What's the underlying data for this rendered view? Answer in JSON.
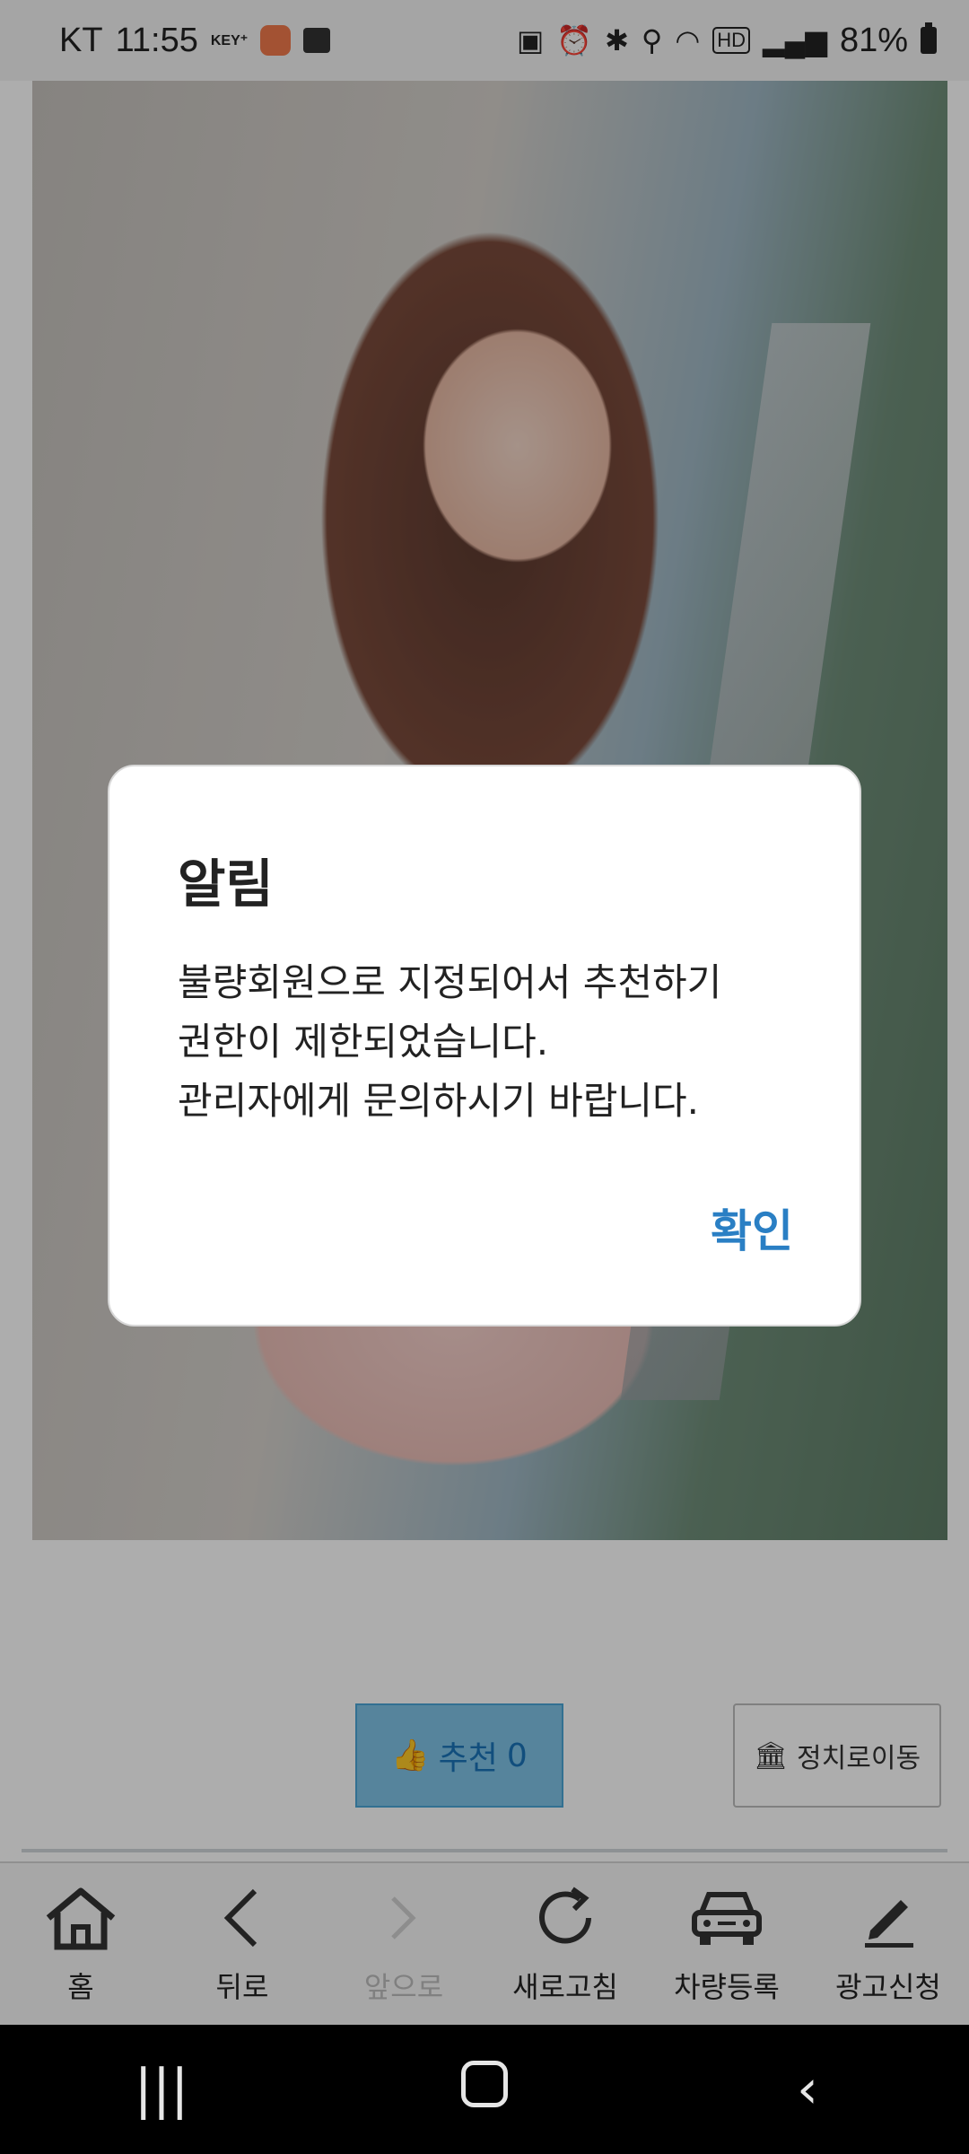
{
  "status_bar": {
    "carrier": "KT",
    "time": "11:55",
    "key_badge": "KEY⁺",
    "battery": "81%"
  },
  "page": {
    "recommend_button": {
      "label": "추천",
      "count": "0"
    },
    "parking_button": {
      "label": "정치로이동"
    }
  },
  "dialog": {
    "title": "알림",
    "message_lines": [
      "불량회원으로 지정되어서 추천하기",
      "권한이 제한되었습니다.",
      "관리자에게 문의하시기 바랍니다."
    ],
    "confirm": "확인"
  },
  "toolbar": {
    "items": [
      {
        "label": "홈",
        "icon": "home-icon",
        "enabled": true
      },
      {
        "label": "뒤로",
        "icon": "back-icon",
        "enabled": true
      },
      {
        "label": "앞으로",
        "icon": "forward-icon",
        "enabled": false
      },
      {
        "label": "새로고침",
        "icon": "refresh-icon",
        "enabled": true
      },
      {
        "label": "차량등록",
        "icon": "car-icon",
        "enabled": true
      },
      {
        "label": "광고신청",
        "icon": "pencil-icon",
        "enabled": true
      }
    ]
  },
  "navbar": {
    "icons": [
      "recent-apps-icon",
      "home-icon",
      "back-icon"
    ]
  }
}
